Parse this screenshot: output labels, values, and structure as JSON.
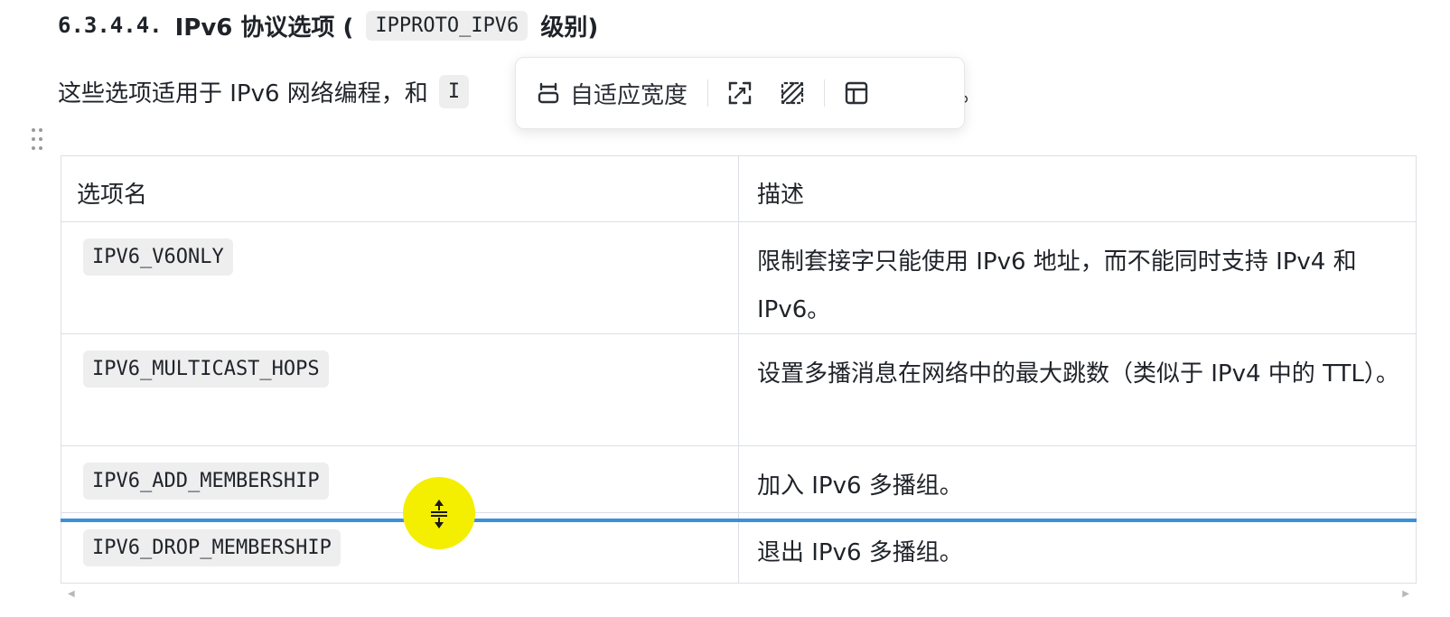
{
  "heading": {
    "number": "6.3.4.4.",
    "title_prefix": "IPv6 协议选项 (",
    "code": "IPPROTO_IPV6",
    "title_suffix": "级别)"
  },
  "paragraph": {
    "text": "这些选项适用于 IPv6 网络编程，和",
    "code_fragment": "I",
    "trailing": "。"
  },
  "toolbar": {
    "fit_width_label": "自适应宽度",
    "icons": [
      "fit-width-icon",
      "fullscreen-icon",
      "no-border-icon",
      "table-layout-icon"
    ]
  },
  "table": {
    "headers": [
      "选项名",
      "描述"
    ],
    "rows": [
      {
        "option": "IPV6_V6ONLY",
        "description": "限制套接字只能使用 IPv6 地址，而不能同时支持 IPv4 和 IPv6。"
      },
      {
        "option": "IPV6_MULTICAST_HOPS",
        "description": "设置多播消息在网络中的最大跳数（类似于 IPv4 中的 TTL）。"
      },
      {
        "option": "IPV6_ADD_MEMBERSHIP",
        "description": "加入 IPv6 多播组。"
      },
      {
        "option": "IPV6_DROP_MEMBERSHIP",
        "description": "退出 IPv6 多播组。"
      }
    ]
  },
  "colors": {
    "resize_line": "#3b8fdd",
    "cursor_highlight": "#f4ee00",
    "code_background": "#eeeeee"
  }
}
